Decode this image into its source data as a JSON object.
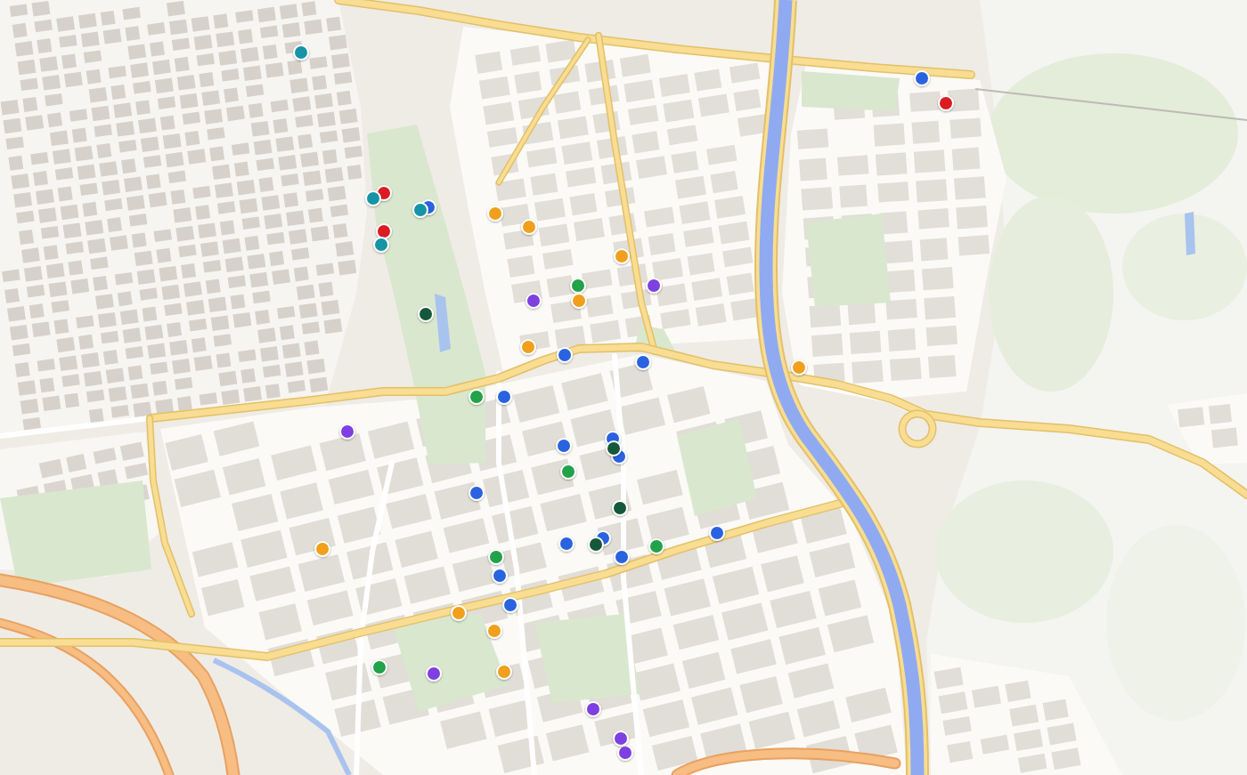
{
  "map": {
    "markers": [
      {
        "color": "#1894a6"
      },
      {
        "color": "#2a64e0"
      },
      {
        "color": "#dc1f24"
      },
      {
        "color": "#dc1f24"
      },
      {
        "color": "#1894a6"
      },
      {
        "color": "#2a64e0"
      },
      {
        "color": "#1894a6"
      },
      {
        "color": "#f0a01c"
      },
      {
        "color": "#f0a01c"
      },
      {
        "color": "#dc1f24"
      },
      {
        "color": "#1894a6"
      },
      {
        "color": "#f0a01c"
      },
      {
        "color": "#22a24a"
      },
      {
        "color": "#7e3fe0"
      },
      {
        "color": "#f0a01c"
      },
      {
        "color": "#7e3fe0"
      },
      {
        "color": "#17593a"
      },
      {
        "color": "#f0a01c"
      },
      {
        "color": "#2a64e0"
      },
      {
        "color": "#2a64e0"
      },
      {
        "color": "#f0a01c"
      },
      {
        "color": "#22a24a"
      },
      {
        "color": "#2a64e0"
      },
      {
        "color": "#7e3fe0"
      },
      {
        "color": "#2a64e0"
      },
      {
        "color": "#2a64e0"
      },
      {
        "color": "#2a64e0"
      },
      {
        "color": "#17593a"
      },
      {
        "color": "#22a24a"
      },
      {
        "color": "#2a64e0"
      },
      {
        "color": "#17593a"
      },
      {
        "color": "#2a64e0"
      },
      {
        "color": "#2a64e0"
      },
      {
        "color": "#2a64e0"
      },
      {
        "color": "#17593a"
      },
      {
        "color": "#22a24a"
      },
      {
        "color": "#f0a01c"
      },
      {
        "color": "#22a24a"
      },
      {
        "color": "#2a64e0"
      },
      {
        "color": "#2a64e0"
      },
      {
        "color": "#2a64e0"
      },
      {
        "color": "#f0a01c"
      },
      {
        "color": "#f0a01c"
      },
      {
        "color": "#22a24a"
      },
      {
        "color": "#f0a01c"
      },
      {
        "color": "#7e3fe0"
      },
      {
        "color": "#7e3fe0"
      },
      {
        "color": "#7e3fe0"
      },
      {
        "color": "#7e3fe0"
      }
    ]
  }
}
